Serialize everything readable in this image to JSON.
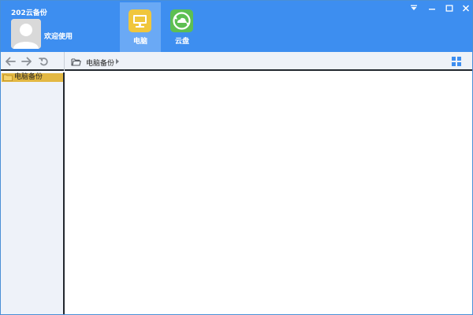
{
  "app": {
    "title": "202云备份",
    "welcome": "欢迎使用"
  },
  "nav_tabs": [
    {
      "label": "电脑",
      "icon": "monitor-icon",
      "active": true,
      "color": "#f0c63c"
    },
    {
      "label": "云盘",
      "icon": "cloud-sync-icon",
      "active": false,
      "color": "#5dbf52"
    }
  ],
  "window_controls": [
    "dropdown-menu-icon",
    "minimize-icon",
    "maximize-icon",
    "close-icon"
  ],
  "toolbar": {
    "nav_buttons": [
      "back-arrow-icon",
      "forward-arrow-icon",
      "refresh-icon"
    ],
    "breadcrumb": "电脑备份",
    "view_icon": "grid-view-icon"
  },
  "sidebar": {
    "items": [
      {
        "label": "电脑备份",
        "icon": "folder-icon",
        "selected": true
      }
    ]
  },
  "colors": {
    "header": "#3d8ef0",
    "active_tab": "#6aa9f5",
    "selected_item": "#e3b843",
    "sidebar_bg": "#eef2f9"
  }
}
